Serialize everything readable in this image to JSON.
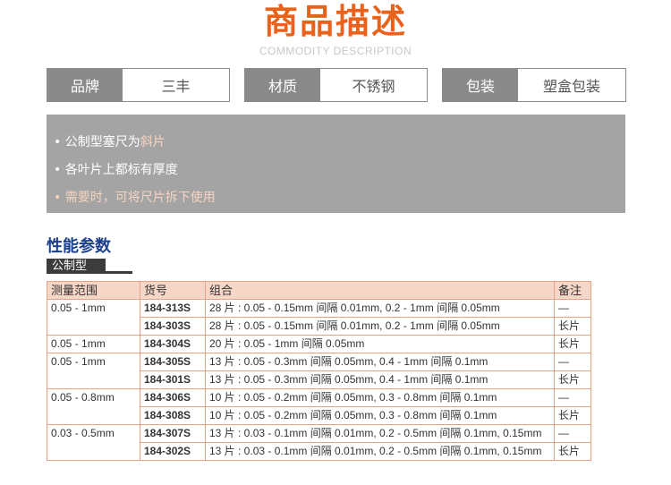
{
  "header": {
    "title": "商品描述",
    "subtitle": "COMMODITY DESCRIPTION"
  },
  "specs": [
    {
      "key": "品牌",
      "value": "三丰"
    },
    {
      "key": "材质",
      "value": "不锈钢"
    },
    {
      "key": "包装",
      "value": "塑盒包装"
    }
  ],
  "features": [
    {
      "prefix": "• 公制型塞尺为",
      "highlight": "斜片"
    },
    {
      "text": "• 各叶片上都标有厚度"
    },
    {
      "text": "• 需要时，可将尺片拆下使用"
    }
  ],
  "section": {
    "title": "性能参数",
    "tag": "公制型"
  },
  "table": {
    "headers": [
      "测量范围",
      "货号",
      "组合",
      "备注"
    ],
    "groups": [
      {
        "range": "0.05 - 1mm",
        "rows": [
          {
            "model": "184-313S",
            "combo": "28 片 : 0.05 - 0.15mm 间隔 0.01mm, 0.2 - 1mm 间隔 0.05mm",
            "note": "—"
          },
          {
            "model": "184-303S",
            "combo": "28 片 : 0.05 - 0.15mm 间隔 0.01mm, 0.2 - 1mm 间隔 0.05mm",
            "note": "长片"
          }
        ]
      },
      {
        "range": "0.05 - 1mm",
        "rows": [
          {
            "model": "184-304S",
            "combo": "20 片 : 0.05 - 1mm 间隔 0.05mm",
            "note": "长片"
          }
        ]
      },
      {
        "range": "0.05 - 1mm",
        "rows": [
          {
            "model": "184-305S",
            "combo": "13 片 : 0.05 - 0.3mm 间隔 0.05mm, 0.4 - 1mm 间隔 0.1mm",
            "note": "—"
          },
          {
            "model": "184-301S",
            "combo": "13 片 : 0.05 - 0.3mm 间隔 0.05mm, 0.4 - 1mm 间隔 0.1mm",
            "note": "长片"
          }
        ]
      },
      {
        "range": "0.05 - 0.8mm",
        "rows": [
          {
            "model": "184-306S",
            "combo": "10 片 : 0.05 - 0.2mm 间隔 0.05mm, 0.3 - 0.8mm 间隔 0.1mm",
            "note": "—"
          },
          {
            "model": "184-308S",
            "combo": "10 片 : 0.05 - 0.2mm 间隔 0.05mm, 0.3 - 0.8mm 间隔 0.1mm",
            "note": "长片"
          }
        ]
      },
      {
        "range": "0.03 - 0.5mm",
        "rows": [
          {
            "model": "184-307S",
            "combo": "13 片 : 0.03 - 0.1mm 间隔 0.01mm, 0.2 - 0.5mm 间隔 0.1mm, 0.15mm",
            "note": "—"
          },
          {
            "model": "184-302S",
            "combo": "13 片 : 0.03 - 0.1mm 间隔 0.01mm, 0.2 - 0.5mm 间隔 0.1mm, 0.15mm",
            "note": "长片"
          }
        ]
      }
    ]
  }
}
